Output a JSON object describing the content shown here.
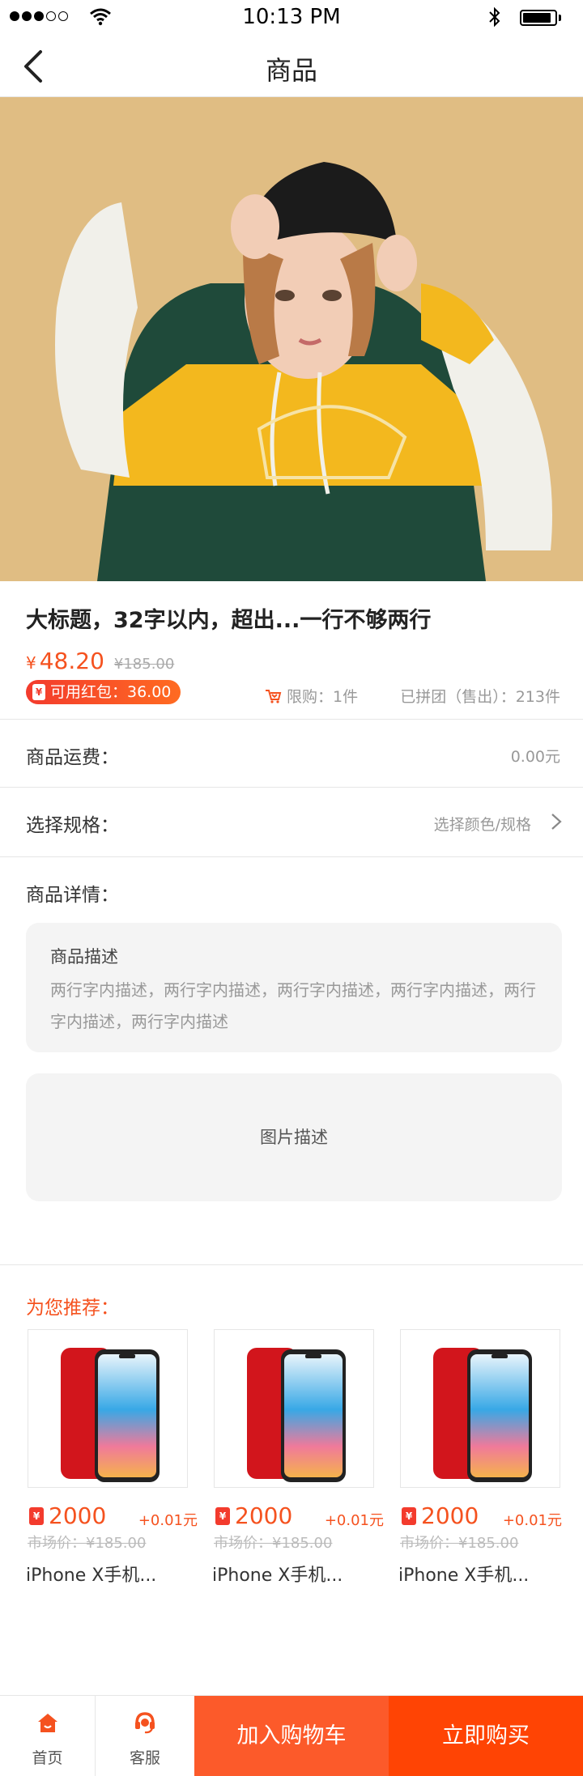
{
  "status_bar": {
    "time": "10:13 PM"
  },
  "nav": {
    "title": "商品"
  },
  "product": {
    "title": "大标题，32字以内，超出...一行不够两行",
    "currency": "¥",
    "price": "48.20",
    "original_price": "¥185.00",
    "coupon_label": "可用红包：36.00",
    "coupon_icon": "¥",
    "limit": "限购：1件",
    "sold": "已拼团（售出）：213件"
  },
  "shipping": {
    "label": "商品运费：",
    "value": "0.00元"
  },
  "spec": {
    "label": "选择规格：",
    "value": "选择颜色/规格"
  },
  "details": {
    "label": "商品详情：",
    "desc_title": "商品描述",
    "desc_text": "两行字内描述，两行字内描述，两行字内描述，两行字内描述，两行字内描述，两行字内描述",
    "image_label": "图片描述"
  },
  "recommend": {
    "title": "为您推荐：",
    "items": [
      {
        "price": "2000",
        "plus": "+0.01元",
        "market": "市场价：¥185.00",
        "name": "iPhone X手机..."
      },
      {
        "price": "2000",
        "plus": "+0.01元",
        "market": "市场价：¥185.00",
        "name": "iPhone X手机..."
      },
      {
        "price": "2000",
        "plus": "+0.01元",
        "market": "市场价：¥185.00",
        "name": "iPhone X手机..."
      }
    ]
  },
  "bottom_bar": {
    "home": "首页",
    "service": "客服",
    "add_to_cart": "加入购物车",
    "buy_now": "立即购买"
  },
  "colors": {
    "accent": "#f5521f",
    "cart": "#fc5a2a",
    "buy": "#ff4404"
  }
}
